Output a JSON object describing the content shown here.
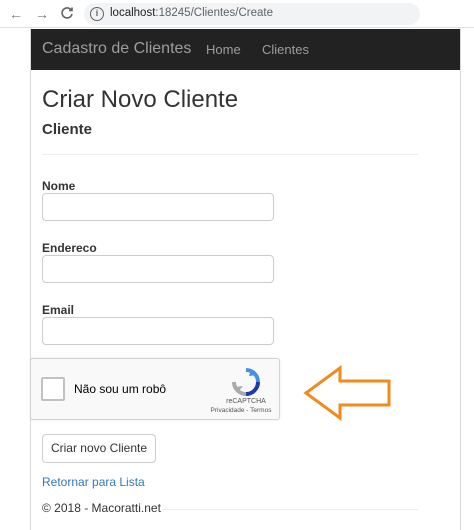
{
  "browser": {
    "url_host": "localhost",
    "url_path": ":18245/Clientes/Create"
  },
  "navbar": {
    "brand": "Cadastro de Clientes",
    "links": [
      "Home",
      "Clientes"
    ]
  },
  "page": {
    "title": "Criar Novo Cliente",
    "subtitle": "Cliente"
  },
  "form": {
    "fields": [
      {
        "label": "Nome",
        "value": ""
      },
      {
        "label": "Endereco",
        "value": ""
      },
      {
        "label": "Email",
        "value": ""
      }
    ],
    "submit_label": "Criar novo Cliente"
  },
  "recaptcha": {
    "checkbox_label": "Não sou um robô",
    "brand": "reCAPTCHA",
    "links": "Privacidade - Termos",
    "checked": false
  },
  "back_link": "Retornar para Lista",
  "footer": "© 2018 - Macoratti.net",
  "colors": {
    "navbar": "#222222",
    "link": "#337ab7",
    "arrow": "#f28a1c"
  }
}
